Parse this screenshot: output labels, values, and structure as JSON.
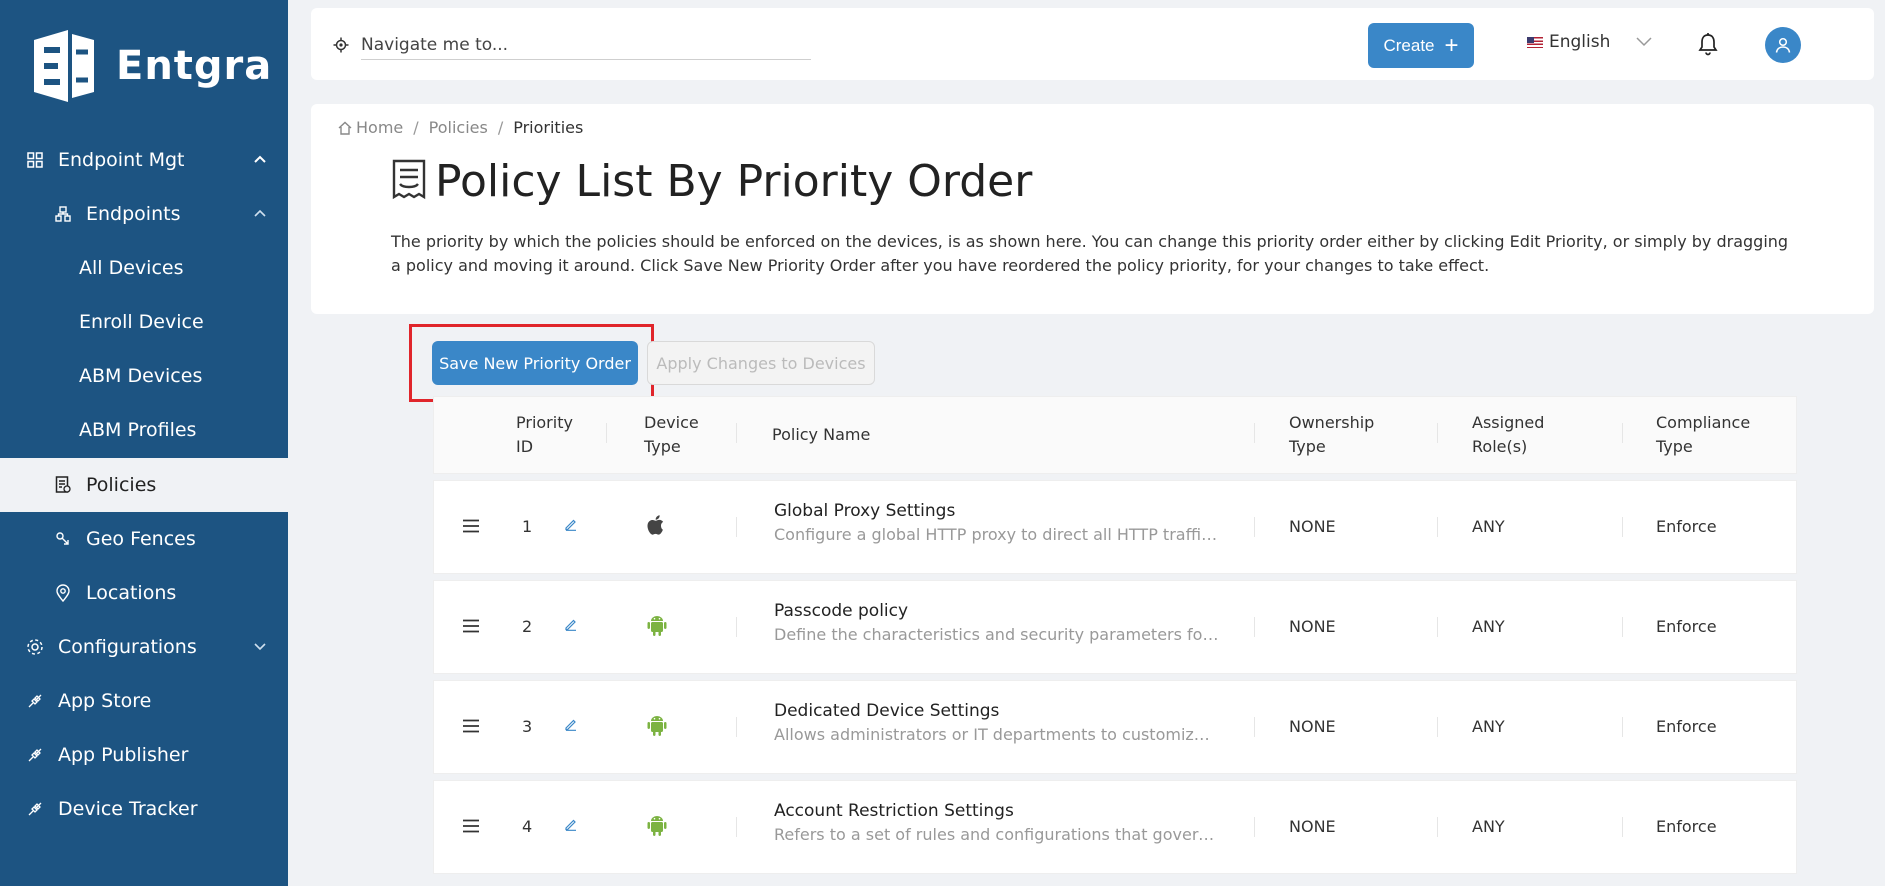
{
  "brand": {
    "name": "Entgra"
  },
  "sidebar": {
    "items": [
      {
        "label": "Endpoint Mgt",
        "icon": "grid-icon"
      },
      {
        "label": "Endpoints",
        "icon": "cluster-icon"
      },
      {
        "label": "All Devices"
      },
      {
        "label": "Enroll Device"
      },
      {
        "label": "ABM Devices"
      },
      {
        "label": "ABM Profiles"
      },
      {
        "label": "Policies",
        "icon": "policy-icon"
      },
      {
        "label": "Geo Fences",
        "icon": "geo-fence-icon"
      },
      {
        "label": "Locations",
        "icon": "location-pin-icon"
      },
      {
        "label": "Configurations",
        "icon": "gear-icon"
      },
      {
        "label": "App Store",
        "icon": "api-icon"
      },
      {
        "label": "App Publisher",
        "icon": "api-icon"
      },
      {
        "label": "Device Tracker",
        "icon": "api-icon"
      }
    ]
  },
  "header": {
    "search_placeholder": "Navigate me to...",
    "create_label": "Create",
    "language": "English"
  },
  "breadcrumb": {
    "home": "Home",
    "policies": "Policies",
    "current": "Priorities"
  },
  "page": {
    "title": "Policy List By Priority Order",
    "description": "The priority by which the policies should be enforced on the devices, is as shown here. You can change this priority order either by clicking Edit Priority, or simply by dragging a policy and moving it around. Click Save New Priority Order after you have reordered the policy priority, for your changes to take effect."
  },
  "actions": {
    "save_label": "Save New Priority Order",
    "apply_label": "Apply Changes to Devices"
  },
  "table": {
    "columns": {
      "priority_id_1": "Priority",
      "priority_id_2": "ID",
      "device_type_1": "Device",
      "device_type_2": "Type",
      "policy_name": "Policy Name",
      "ownership_1": "Ownership",
      "ownership_2": "Type",
      "roles_1": "Assigned",
      "roles_2": "Role(s)",
      "compliance_1": "Compliance",
      "compliance_2": "Type"
    },
    "rows": [
      {
        "id": "1",
        "device": "apple-icon",
        "name": "Global Proxy Settings",
        "desc": "Configure a global HTTP proxy to direct all HTTP traffic fr...",
        "ownership": "NONE",
        "roles": "ANY",
        "compliance": "Enforce"
      },
      {
        "id": "2",
        "device": "android-icon",
        "name": "Passcode policy",
        "desc": "Define the characteristics and security parameters for ...",
        "ownership": "NONE",
        "roles": "ANY",
        "compliance": "Enforce"
      },
      {
        "id": "3",
        "device": "android-icon",
        "name": "Dedicated Device Settings",
        "desc": "Allows administrators or IT departments to customize a...",
        "ownership": "NONE",
        "roles": "ANY",
        "compliance": "Enforce"
      },
      {
        "id": "4",
        "device": "android-icon",
        "name": "Account Restriction Settings",
        "desc": "Refers to a set of rules and configurations that govern t...",
        "ownership": "NONE",
        "roles": "ANY",
        "compliance": "Enforce"
      }
    ]
  },
  "colors": {
    "sidebar": "#1d5482",
    "accent": "#3a87c8",
    "android": "#7cb342",
    "highlight": "#e0252b"
  }
}
